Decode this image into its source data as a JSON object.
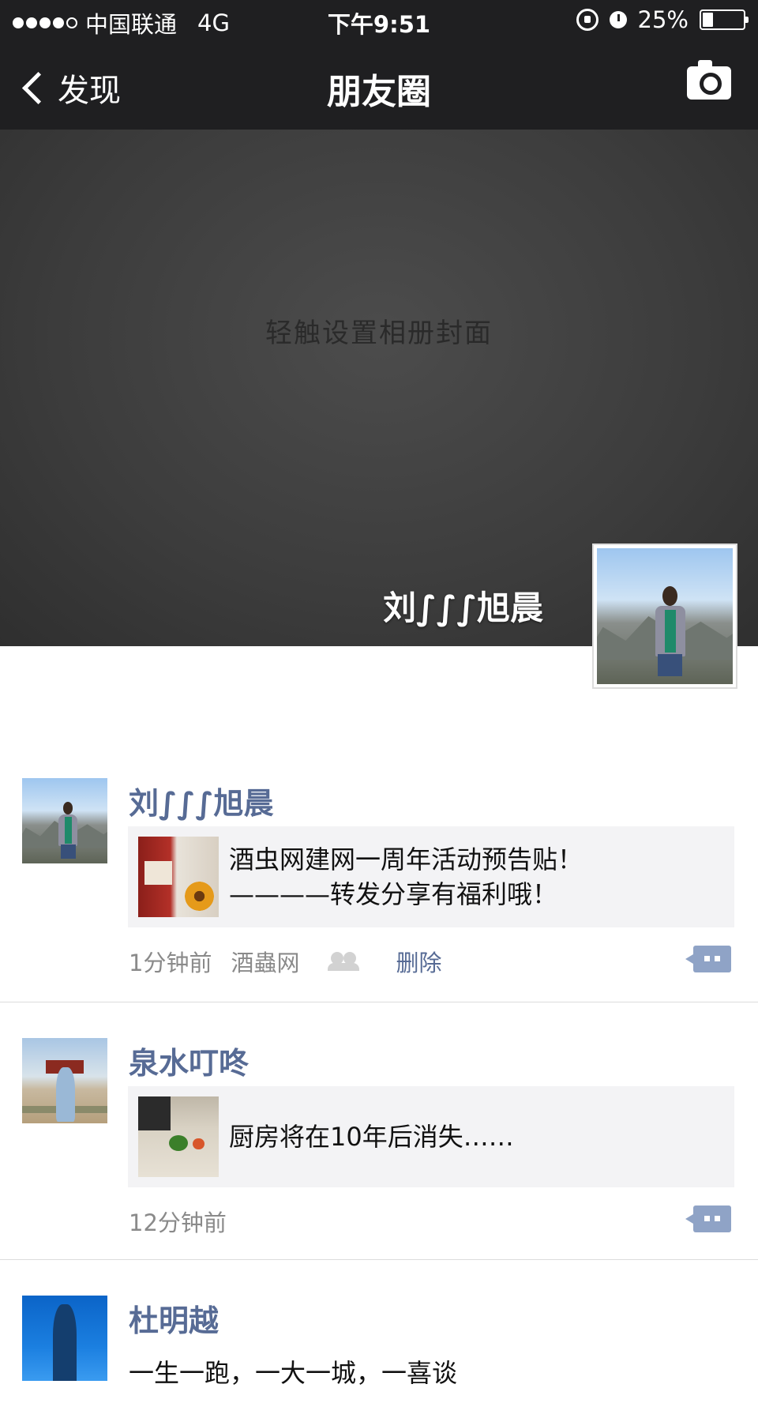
{
  "status_bar": {
    "carrier": "中国联通",
    "network": "4G",
    "time": "下午9:51",
    "battery_percent": "25%",
    "battery_level": 0.25
  },
  "nav": {
    "back_label": "发现",
    "title": "朋友圈"
  },
  "cover": {
    "hint": "轻触设置相册封面",
    "user_name": "刘∫∫∫旭晨"
  },
  "posts": [
    {
      "name": "刘∫∫∫旭晨",
      "share_lines": [
        "酒虫网建网一周年活动预告贴！",
        "————转发分享有福利哦！"
      ],
      "time": "1分钟前",
      "source": "酒蟲网",
      "delete_label": "删除"
    },
    {
      "name": "泉水叮咚",
      "share_lines": [
        "厨房将在10年后消失……"
      ],
      "time": "12分钟前"
    },
    {
      "name": "杜明越",
      "preview": "一生一跑，一大一城，一喜谈"
    }
  ],
  "colors": {
    "nav_bg": "#1f1f21",
    "link_blue": "#576b95",
    "share_bg": "#f3f3f5"
  }
}
